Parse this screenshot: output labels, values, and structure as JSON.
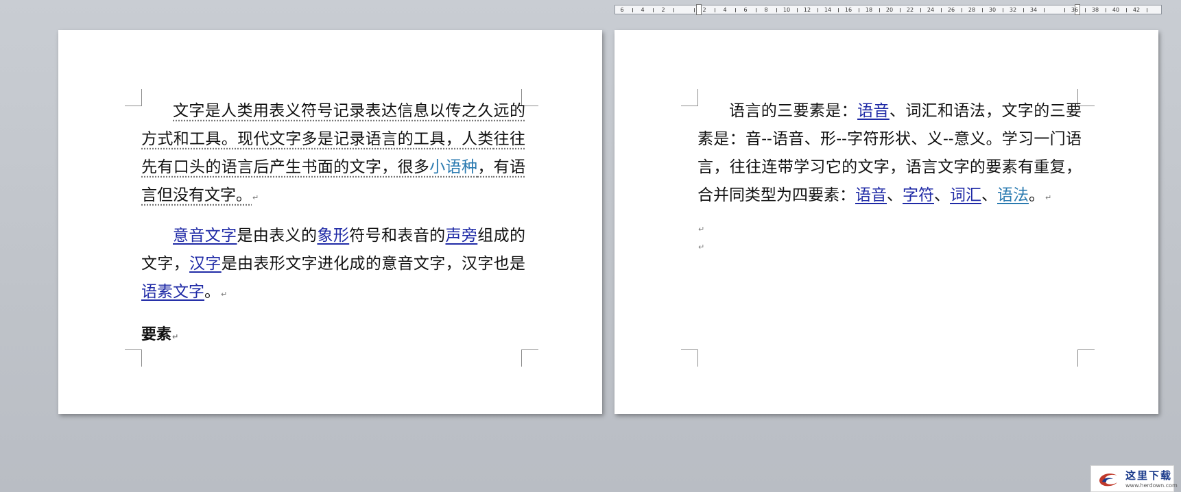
{
  "ruler": {
    "ticks": [
      "6",
      "4",
      "2",
      "",
      "2",
      "4",
      "6",
      "8",
      "10",
      "12",
      "14",
      "16",
      "18",
      "20",
      "22",
      "24",
      "26",
      "28",
      "30",
      "32",
      "34",
      "",
      "36",
      "38",
      "40",
      "42"
    ]
  },
  "left_page": {
    "para1_line1": "文字是人类用表义符号记录表达信息以传之久远",
    "para1_line2": "的方式和工具。现代文字多是记录语言的工具，人类",
    "para1_line3a": "往往先有口头的语言后产生书面的文字，很多",
    "para1_link": "小语种",
    "para1_line3b": "，",
    "para1_line4": "有语言但没有文字。",
    "para2_link1": "意音文字",
    "para2_t1": "是由表义的",
    "para2_link2": "象形",
    "para2_t2": "符号和表音的",
    "para2_link3": "声旁",
    "para2_t3": "组成的文字，",
    "para2_link4": "汉字",
    "para2_t4": "是由表形文字进化成的意音文字，汉字也是",
    "para2_link5": "语素文字",
    "para2_t5": "。",
    "heading": "要素"
  },
  "right_page": {
    "t1": "语言的三要素是：",
    "link1": "语音",
    "t2": "、词汇和语法，文字的三要素是：音--语音、形--字符形状、义--意义。学习一门语言，往往连带学习它的文字，语言文字的要素有重复，合并同类型为四要素：",
    "link2": "语音",
    "sep1": "、",
    "link3": "字符",
    "sep2": "、",
    "link4": "词汇",
    "sep3": "、",
    "link5": "语法",
    "t3": "。"
  },
  "paragraph_mark": "↵",
  "logo": {
    "name": "这里下载",
    "url": "www.herdown.com"
  }
}
